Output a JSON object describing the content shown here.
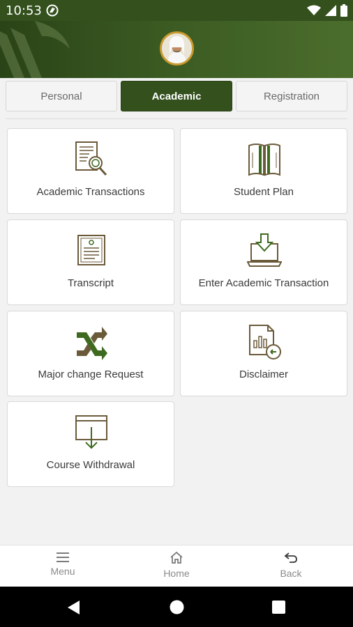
{
  "status_bar": {
    "time": "10:53"
  },
  "tabs": [
    {
      "label": "Personal",
      "active": false
    },
    {
      "label": "Academic",
      "active": true
    },
    {
      "label": "Registration",
      "active": false
    }
  ],
  "cards": [
    {
      "label": "Academic Transactions",
      "icon": "document-search-icon"
    },
    {
      "label": "Student Plan",
      "icon": "open-book-icon"
    },
    {
      "label": "Transcript",
      "icon": "transcript-icon"
    },
    {
      "label": "Enter Academic Transaction",
      "icon": "laptop-download-icon"
    },
    {
      "label": "Major change Request",
      "icon": "swap-arrows-icon"
    },
    {
      "label": "Disclaimer",
      "icon": "report-return-icon"
    },
    {
      "label": "Course Withdrawal",
      "icon": "window-download-icon"
    }
  ],
  "bottom_nav": [
    {
      "label": "Menu",
      "icon": "menu-icon"
    },
    {
      "label": "Home",
      "icon": "home-icon"
    },
    {
      "label": "Back",
      "icon": "back-icon"
    }
  ],
  "colors": {
    "primary": "#33501d",
    "accent": "#c99a2e",
    "icon_brown": "#6b5a3a",
    "icon_green": "#3e6a1f"
  }
}
